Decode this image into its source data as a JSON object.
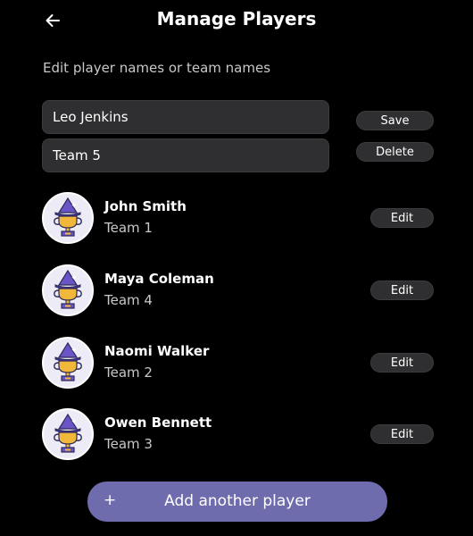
{
  "header": {
    "title": "Manage Players",
    "back_icon": "arrow-left-icon"
  },
  "instructions": "Edit player names or team names",
  "edit_form": {
    "name_value": "Leo Jenkins",
    "team_value": "Team 5",
    "save_label": "Save",
    "delete_label": "Delete"
  },
  "players": [
    {
      "name": "John Smith",
      "team": "Team 1",
      "edit_label": "Edit",
      "avatar_icon": "wizard-trophy-icon"
    },
    {
      "name": "Maya Coleman",
      "team": "Team 4",
      "edit_label": "Edit",
      "avatar_icon": "wizard-trophy-icon"
    },
    {
      "name": "Naomi Walker",
      "team": "Team 2",
      "edit_label": "Edit",
      "avatar_icon": "wizard-trophy-icon"
    },
    {
      "name": "Owen Bennett",
      "team": "Team 3",
      "edit_label": "Edit",
      "avatar_icon": "wizard-trophy-icon"
    }
  ],
  "add_button": {
    "icon": "+",
    "label": "Add another player"
  },
  "colors": {
    "background": "#000000",
    "accent": "#6f6cae",
    "control_bg": "#2f2f31",
    "avatar_bg": "#ecebf6",
    "trophy_gold": "#f0b73a",
    "hat_purple": "#6b55c6"
  }
}
